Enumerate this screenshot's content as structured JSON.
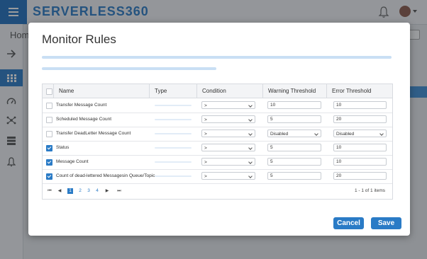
{
  "app": {
    "logo": "SERVERLESS360",
    "breadcrumb": "Home",
    "accent": "#2a7bc6"
  },
  "sidebar": {
    "items": [
      {
        "icon": "arrow-right-icon"
      },
      {
        "icon": "grid-icon",
        "active": true
      },
      {
        "icon": "dashboard-icon"
      },
      {
        "icon": "network-icon"
      },
      {
        "icon": "server-icon"
      },
      {
        "icon": "bell-icon"
      }
    ]
  },
  "modal": {
    "title": "Monitor Rules",
    "columns": [
      "Name",
      "Type",
      "Condition",
      "Warning Threshold",
      "Error Threshold"
    ],
    "rows": [
      {
        "checked": false,
        "name": "Transfer Message Count",
        "condition": ">",
        "warning": "10",
        "warning_kind": "input",
        "error": "10",
        "error_kind": "input"
      },
      {
        "checked": false,
        "name": "Scheduled Message Count",
        "condition": ">",
        "warning": "5",
        "warning_kind": "input",
        "error": "20",
        "error_kind": "input"
      },
      {
        "checked": false,
        "name": "Transfer DeadLetter Message Count",
        "condition": ">",
        "warning": "Disabled",
        "warning_kind": "select",
        "error": "Disabled",
        "error_kind": "select"
      },
      {
        "checked": true,
        "name": "Status",
        "condition": ">",
        "warning": "5",
        "warning_kind": "input",
        "error": "10",
        "error_kind": "input"
      },
      {
        "checked": true,
        "name": "Message Count",
        "condition": ">",
        "warning": "5",
        "warning_kind": "input",
        "error": "10",
        "error_kind": "input"
      },
      {
        "checked": true,
        "name": "Count of dead-lettered Messagesin Queue/Topic",
        "condition": ">",
        "warning": "5",
        "warning_kind": "input",
        "error": "20",
        "error_kind": "input"
      }
    ],
    "pager": {
      "first": "⏮",
      "prev": "◀",
      "pages": [
        "1",
        "2",
        "3",
        "4"
      ],
      "current": "1",
      "next": "▶",
      "last": "⏭",
      "info": "1 - 1 of 1 items"
    },
    "cancel_label": "Cancel",
    "save_label": "Save"
  }
}
